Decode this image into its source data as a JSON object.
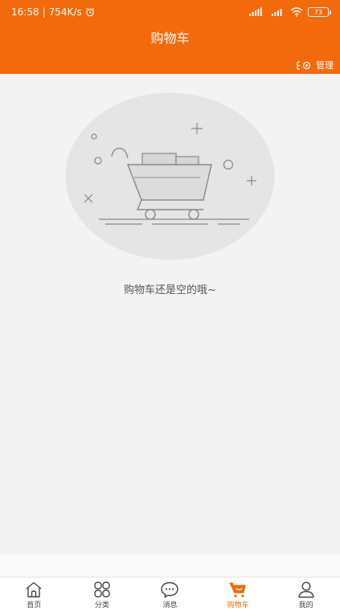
{
  "status_bar": {
    "time": "16:58",
    "speed": "754K/s",
    "battery": "73"
  },
  "header": {
    "title": "购物车",
    "manage_label": "管理"
  },
  "empty_state": {
    "message": "购物车还是空的哦~"
  },
  "tabbar": {
    "items": [
      {
        "label": "首页",
        "icon": "home-icon"
      },
      {
        "label": "分类",
        "icon": "category-icon"
      },
      {
        "label": "消息",
        "icon": "message-icon"
      },
      {
        "label": "购物车",
        "icon": "cart-icon"
      },
      {
        "label": "我的",
        "icon": "user-icon"
      }
    ],
    "active_index": 3
  },
  "colors": {
    "accent": "#f26a0c",
    "background": "#f3f3f3"
  }
}
